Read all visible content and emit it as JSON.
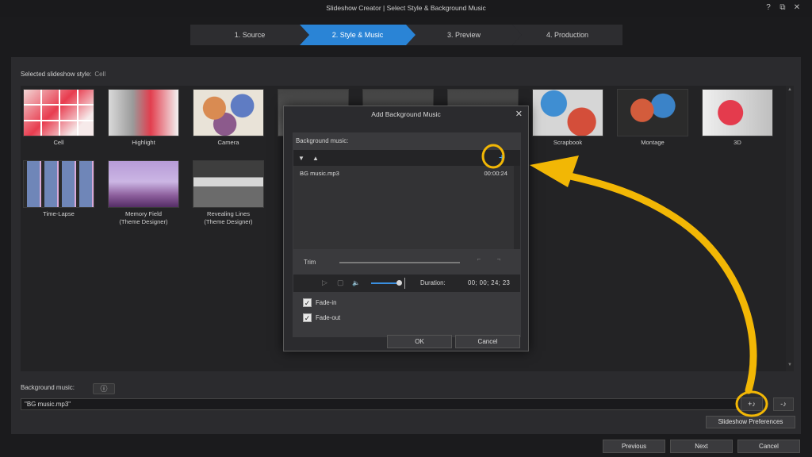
{
  "window": {
    "title": "Slideshow Creator | Select Style & Background Music",
    "help_icon": "?",
    "restore_icon": "⧉",
    "close_icon": "✕"
  },
  "wizard": {
    "steps": [
      {
        "label": "1. Source"
      },
      {
        "label": "2. Style & Music",
        "active": true
      },
      {
        "label": "3. Preview"
      },
      {
        "label": "4. Production"
      }
    ]
  },
  "style": {
    "label": "Selected slideshow style:",
    "value": "Cell"
  },
  "tiles": [
    {
      "name": "Cell"
    },
    {
      "name": "Highlight"
    },
    {
      "name": "Camera"
    },
    {
      "name": "Scrapbook"
    },
    {
      "name": "Montage"
    },
    {
      "name": "3D"
    },
    {
      "name": "Time-Lapse"
    },
    {
      "name": "Memory Field\n(Theme Designer)"
    },
    {
      "name": "Revealing Lines\n(Theme Designer)"
    }
  ],
  "music": {
    "label": "Background music:",
    "info_icon": "ⓘ",
    "value": "\"BG music.mp3\"",
    "add_icon": "+♪",
    "remove_icon": "-♪",
    "prefs_label": "Slideshow Preferences"
  },
  "nav": {
    "previous": "Previous",
    "next": "Next",
    "cancel": "Cancel"
  },
  "dialog": {
    "title": "Add Background Music",
    "close_icon": "✕",
    "list_label": "Background music:",
    "down_icon": "▼",
    "up_icon": "▲",
    "add_icon": "+",
    "items": [
      {
        "file": "BG music.mp3",
        "duration": "00:00:24"
      }
    ],
    "trim_label": "Trim",
    "play_icon": "▷",
    "stop_icon": "▢",
    "volume_icon": "🔈",
    "duration_label": "Duration:",
    "duration_value": "00; 00; 24; 23",
    "fade_in_label": "Fade-in",
    "fade_in_checked": true,
    "fade_out_label": "Fade-out",
    "fade_out_checked": true,
    "ok_label": "OK",
    "cancel_label": "Cancel"
  },
  "colors": {
    "accent": "#2a84d6",
    "annotation": "#f2b705",
    "background": "#1b1b1d"
  }
}
